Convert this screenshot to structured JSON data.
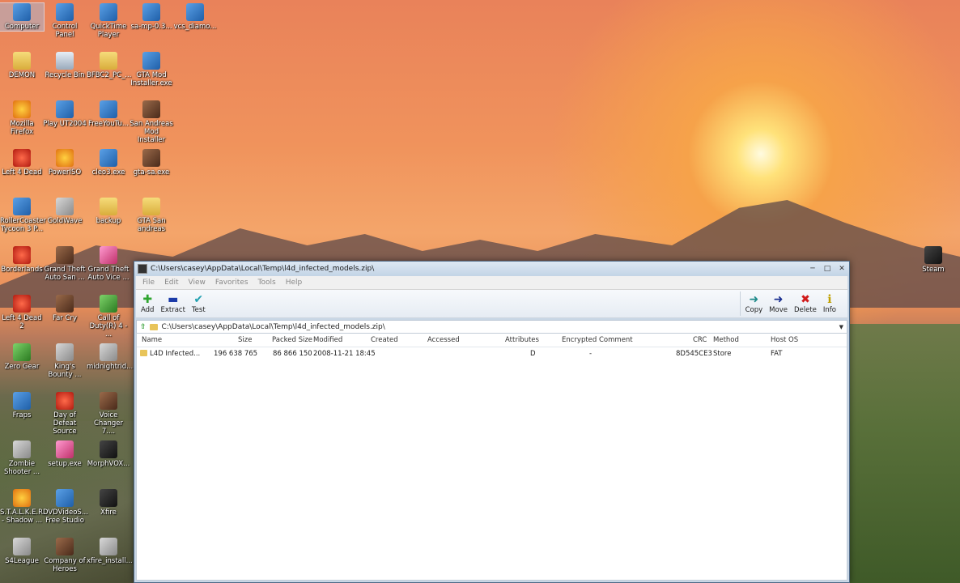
{
  "desktop": {
    "icons": [
      {
        "label": "Computer",
        "icon": "computer-icon"
      },
      {
        "label": "Control Panel",
        "icon": "control-panel-icon"
      },
      {
        "label": "QuickTime Player",
        "icon": "quicktime-icon"
      },
      {
        "label": "sa-mp-0.3...",
        "icon": "samp-installer-icon"
      },
      {
        "label": "vcs_diamo...",
        "icon": "vcs-file-icon"
      },
      {
        "label": "DEMON",
        "icon": "folder-icon"
      },
      {
        "label": "Recycle Bin",
        "icon": "recycle-bin-icon"
      },
      {
        "label": "BFBC2_PC_...",
        "icon": "folder-icon"
      },
      {
        "label": "GTA Mod Installer.exe",
        "icon": "gta-mod-installer-icon"
      },
      {
        "label": "Mozilla Firefox",
        "icon": "firefox-icon"
      },
      {
        "label": "Play UT2004",
        "icon": "ut2004-icon"
      },
      {
        "label": "FreeYouTu...",
        "icon": "freeyoutube-icon"
      },
      {
        "label": "San Andreas Mod Installer",
        "icon": "sa-mod-installer-icon"
      },
      {
        "label": "Left 4 Dead",
        "icon": "left4dead-icon"
      },
      {
        "label": "PowerISO",
        "icon": "poweriso-icon"
      },
      {
        "label": "cleo3.exe",
        "icon": "cleo-icon"
      },
      {
        "label": "gta-sa.exe",
        "icon": "gta-sa-icon"
      },
      {
        "label": "RollerCoaster Tycoon 3 P...",
        "icon": "rct3-icon"
      },
      {
        "label": "GoldWave",
        "icon": "goldwave-icon"
      },
      {
        "label": "backup",
        "icon": "folder-icon"
      },
      {
        "label": "GTA San andreas",
        "icon": "folder-icon"
      },
      {
        "label": "Borderlands",
        "icon": "borderlands-icon"
      },
      {
        "label": "Grand Theft Auto San ...",
        "icon": "gta-sa-game-icon"
      },
      {
        "label": "Grand Theft Auto Vice ...",
        "icon": "gta-vc-icon"
      },
      {
        "label": "Left 4 Dead 2",
        "icon": "left4dead2-icon"
      },
      {
        "label": "Far Cry",
        "icon": "farcry-icon"
      },
      {
        "label": "Call of Duty(R) 4 - ...",
        "icon": "cod4-icon"
      },
      {
        "label": "Zero Gear",
        "icon": "zerogear-icon"
      },
      {
        "label": "King's Bounty ...",
        "icon": "kings-bounty-icon"
      },
      {
        "label": "midnightrid...",
        "icon": "wav-file-icon"
      },
      {
        "label": "Fraps",
        "icon": "fraps-icon"
      },
      {
        "label": "Day of Defeat Source",
        "icon": "dod-source-icon"
      },
      {
        "label": "Voice Changer 7....",
        "icon": "voice-changer-icon"
      },
      {
        "label": "Zombie Shooter ...",
        "icon": "zombie-shooter-icon"
      },
      {
        "label": "setup.exe",
        "icon": "setup-icon"
      },
      {
        "label": "MorphVOX...",
        "icon": "morphvox-icon"
      },
      {
        "label": "S.T.A.L.K.E.R. - Shadow ...",
        "icon": "stalker-icon"
      },
      {
        "label": "DVDVideoS... Free Studio",
        "icon": "dvdvideosoft-icon"
      },
      {
        "label": "Xfire",
        "icon": "xfire-icon"
      },
      {
        "label": "S4League",
        "icon": "s4league-icon"
      },
      {
        "label": "Company of Heroes",
        "icon": "coh-icon"
      },
      {
        "label": "xfire_install...",
        "icon": "xfire-installer-icon"
      },
      {
        "label": "Steam",
        "icon": "steam-icon"
      }
    ]
  },
  "window": {
    "title": "C:\\Users\\casey\\AppData\\Local\\Temp\\l4d_infected_models.zip\\",
    "menu": [
      "File",
      "Edit",
      "View",
      "Favorites",
      "Tools",
      "Help"
    ],
    "toolbar": {
      "left": [
        {
          "label": "Add",
          "icon": "add-icon",
          "glyph": "✚",
          "color": "#2fa52f"
        },
        {
          "label": "Extract",
          "icon": "extract-icon",
          "glyph": "▬",
          "color": "#1a3aa8"
        },
        {
          "label": "Test",
          "icon": "test-icon",
          "glyph": "✔",
          "color": "#20a0b0"
        }
      ],
      "right": [
        {
          "label": "Copy",
          "icon": "copy-icon",
          "glyph": "➜",
          "color": "#1f8a8a"
        },
        {
          "label": "Move",
          "icon": "move-icon",
          "glyph": "➜",
          "color": "#1a2f90"
        },
        {
          "label": "Delete",
          "icon": "delete-icon",
          "glyph": "✖",
          "color": "#d01a1a"
        },
        {
          "label": "Info",
          "icon": "info-icon",
          "glyph": "ℹ",
          "color": "#c0a000"
        }
      ]
    },
    "address": "C:\\Users\\casey\\AppData\\Local\\Temp\\l4d_infected_models.zip\\",
    "columns": [
      "Name",
      "Size",
      "Packed Size",
      "Modified",
      "Created",
      "Accessed",
      "Attributes",
      "Encrypted",
      "Comment",
      "CRC",
      "Method",
      "Host OS"
    ],
    "rows": [
      {
        "Name": "L4D Infected...",
        "Size": "196 638 765",
        "Packed Size": "86 866 150",
        "Modified": "2008-11-21 18:45",
        "Created": "",
        "Accessed": "",
        "Attributes": "D",
        "Encrypted": "-",
        "Comment": "",
        "CRC": "8D545CE3",
        "Method": "Store",
        "Host OS": "FAT"
      }
    ]
  }
}
